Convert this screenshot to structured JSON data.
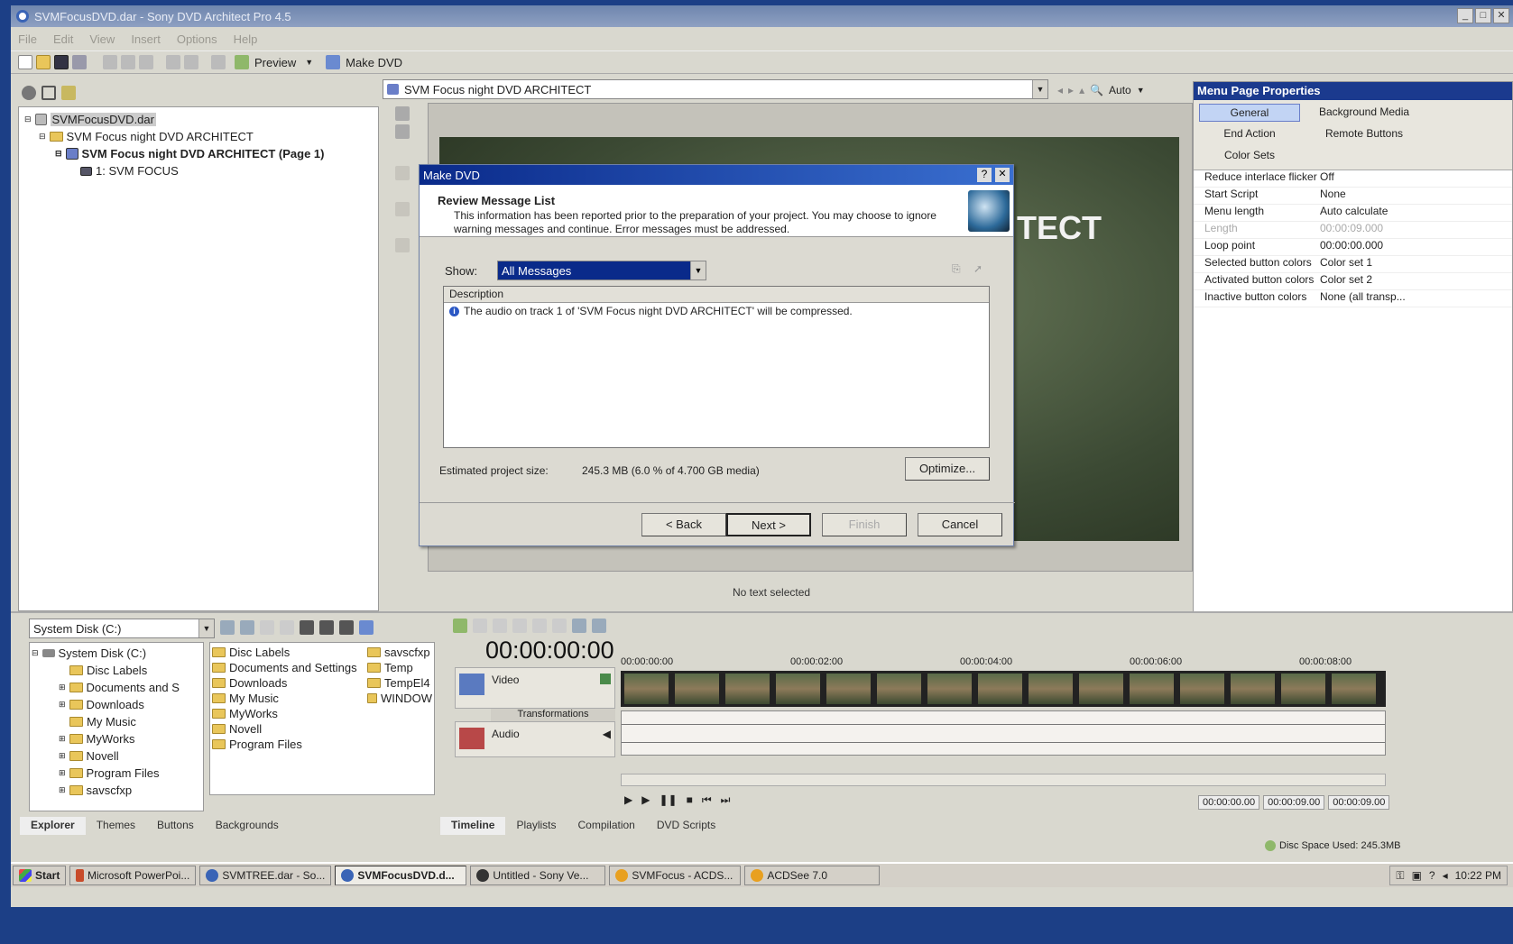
{
  "app": {
    "title": "SVMFocusDVD.dar - Sony DVD Architect Pro 4.5"
  },
  "menu": [
    "File",
    "Edit",
    "View",
    "Insert",
    "Options",
    "Help"
  ],
  "toolbar": {
    "preview_label": "Preview",
    "makedvd_label": "Make DVD"
  },
  "project_tree": {
    "root": "SVMFocusDVD.dar",
    "item1": "SVM Focus night  DVD ARCHITECT",
    "item2": "SVM Focus night  DVD ARCHITECT (Page 1)",
    "item3": "1: SVM FOCUS"
  },
  "menu_combo": {
    "value": "SVM Focus night  DVD ARCHITECT"
  },
  "zoom": {
    "label": "Auto"
  },
  "preview": {
    "overlay_text": "TECT",
    "status": "No text selected"
  },
  "dialog": {
    "title": "Make DVD",
    "help": "?",
    "close": "✕",
    "heading": "Review Message List",
    "subtext": "This information has been reported prior to the preparation of your project. You may choose to ignore warning messages and continue.  Error messages must be addressed.",
    "show_label": "Show:",
    "show_value": "All Messages",
    "col_description": "Description",
    "message": "The audio on track 1 of 'SVM Focus night  DVD ARCHITECT' will be compressed.",
    "size_label": "Estimated project size:",
    "size_value": "245.3 MB  (6.0 % of 4.700 GB media)",
    "optimize": "Optimize...",
    "back": "< Back",
    "next": "Next >",
    "finish": "Finish",
    "cancel": "Cancel"
  },
  "props": {
    "title": "Menu Page Properties",
    "tabs": [
      "General",
      "Background Media",
      "End Action",
      "Remote Buttons",
      "Color Sets"
    ],
    "rows": [
      {
        "k": "Reduce interlace flicker",
        "v": "Off"
      },
      {
        "k": "Start Script",
        "v": "None"
      },
      {
        "k": "Menu length",
        "v": "Auto calculate"
      },
      {
        "k": "Length",
        "v": "00:00:09.000"
      },
      {
        "k": "Loop point",
        "v": "00:00:00.000"
      },
      {
        "k": "Selected button colors",
        "v": "Color set 1"
      },
      {
        "k": "Activated button colors",
        "v": "Color set 2"
      },
      {
        "k": "Inactive button colors",
        "v": "None (all transp..."
      }
    ]
  },
  "explorer": {
    "drive": "System Disk (C:)",
    "tree": [
      "System Disk (C:)",
      "Disc Labels",
      "Documents and S",
      "Downloads",
      "My Music",
      "MyWorks",
      "Novell",
      "Program Files",
      "savscfxp"
    ],
    "files_col1": [
      "Disc Labels",
      "Documents and Settings",
      "Downloads",
      "My Music",
      "MyWorks",
      "Novell",
      "Program Files"
    ],
    "files_col2": [
      "savscfxp",
      "Temp",
      "TempEl4",
      "WINDOW"
    ],
    "tabs": [
      "Explorer",
      "Themes",
      "Buttons",
      "Backgrounds"
    ]
  },
  "timeline": {
    "time": "00:00:00:00",
    "video_label": "Video",
    "transform_label": "Transformations",
    "audio_label": "Audio",
    "ruler": [
      "00:00:00:00",
      "00:00:02:00",
      "00:00:04:00",
      "00:00:06:00",
      "00:00:08:00"
    ],
    "readouts": [
      "00:00:00.00",
      "00:00:09.00",
      "00:00:09.00"
    ],
    "tabs": [
      "Timeline",
      "Playlists",
      "Compilation",
      "DVD Scripts"
    ]
  },
  "status": {
    "disc_space": "Disc Space Used: 245.3MB"
  },
  "taskbar": {
    "start": "Start",
    "items": [
      "Microsoft PowerPoi...",
      "SVMTREE.dar - So...",
      "SVMFocusDVD.d...",
      "Untitled - Sony Ve...",
      "SVMFocus - ACDS...",
      "ACDSee 7.0"
    ],
    "clock": "10:22 PM"
  },
  "colors": {
    "desktop": "#1c3f86",
    "titlebar": "#0a2a8a",
    "accent": "#3a6fd0"
  }
}
